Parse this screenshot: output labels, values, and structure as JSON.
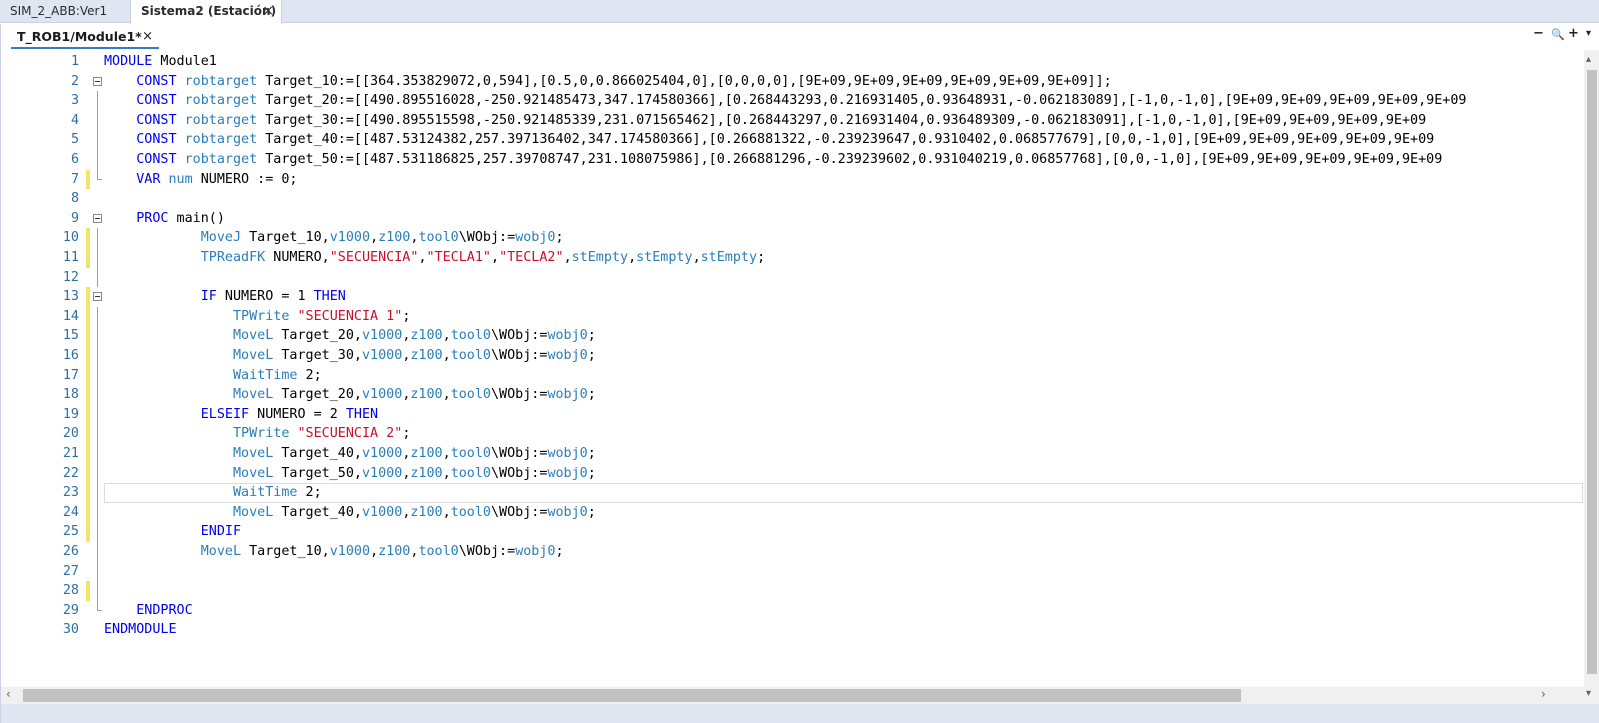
{
  "tabs": [
    {
      "label": "SIM_2_ABB:Ver1"
    },
    {
      "label": "Sistema2 (Estación)",
      "close": "×"
    }
  ],
  "editor_tab": {
    "label": "T_ROB1/Module1*",
    "close": "×"
  },
  "controls": {
    "minimize": "−",
    "zoom": "🔍",
    "add": "+",
    "menu": "▾"
  },
  "scrollbar": {
    "left_arrow": "‹",
    "right_arrow": "›",
    "up_arrow": "▴",
    "down_arrow": "▾"
  },
  "code": {
    "line_numbers": [
      "1",
      "2",
      "3",
      "4",
      "5",
      "6",
      "7",
      "8",
      "9",
      "10",
      "11",
      "12",
      "13",
      "14",
      "15",
      "16",
      "17",
      "18",
      "19",
      "20",
      "21",
      "22",
      "23",
      "24",
      "25",
      "26",
      "27",
      "28",
      "29",
      "30"
    ],
    "lines": [
      [
        [
          "kw",
          "MODULE"
        ],
        [
          "id",
          " Module1"
        ]
      ],
      [
        [
          "id",
          "    "
        ],
        [
          "kw",
          "CONST"
        ],
        [
          "id",
          " "
        ],
        [
          "ty",
          "robtarget"
        ],
        [
          "id",
          " Target_10:=[[364.353829072,0,594],[0.5,0,0.866025404,0],[0,0,0,0],[9E+09,9E+09,9E+09,9E+09,9E+09,9E+09]];"
        ]
      ],
      [
        [
          "id",
          "    "
        ],
        [
          "kw",
          "CONST"
        ],
        [
          "id",
          " "
        ],
        [
          "ty",
          "robtarget"
        ],
        [
          "id",
          " Target_20:=[[490.895516028,-250.921485473,347.174580366],[0.268443293,0.216931405,0.93648931,-0.062183089],[-1,0,-1,0],[9E+09,9E+09,9E+09,9E+09,9E+09"
        ]
      ],
      [
        [
          "id",
          "    "
        ],
        [
          "kw",
          "CONST"
        ],
        [
          "id",
          " "
        ],
        [
          "ty",
          "robtarget"
        ],
        [
          "id",
          " Target_30:=[[490.895515598,-250.921485339,231.071565462],[0.268443297,0.216931404,0.936489309,-0.062183091],[-1,0,-1,0],[9E+09,9E+09,9E+09,9E+09"
        ]
      ],
      [
        [
          "id",
          "    "
        ],
        [
          "kw",
          "CONST"
        ],
        [
          "id",
          " "
        ],
        [
          "ty",
          "robtarget"
        ],
        [
          "id",
          " Target_40:=[[487.53124382,257.397136402,347.174580366],[0.266881322,-0.239239647,0.9310402,0.068577679],[0,0,-1,0],[9E+09,9E+09,9E+09,9E+09,9E+09"
        ]
      ],
      [
        [
          "id",
          "    "
        ],
        [
          "kw",
          "CONST"
        ],
        [
          "id",
          " "
        ],
        [
          "ty",
          "robtarget"
        ],
        [
          "id",
          " Target_50:=[[487.531186825,257.39708747,231.108075986],[0.266881296,-0.239239602,0.931040219,0.06857768],[0,0,-1,0],[9E+09,9E+09,9E+09,9E+09,9E+09"
        ]
      ],
      [
        [
          "id",
          "    "
        ],
        [
          "kw",
          "VAR"
        ],
        [
          "id",
          " "
        ],
        [
          "ty",
          "num"
        ],
        [
          "id",
          " NUMERO := 0;"
        ]
      ],
      [
        [
          "id",
          ""
        ]
      ],
      [
        [
          "id",
          "    "
        ],
        [
          "kw",
          "PROC"
        ],
        [
          "id",
          " main()"
        ]
      ],
      [
        [
          "id",
          "            "
        ],
        [
          "fn",
          "MoveJ"
        ],
        [
          "id",
          " Target_10,"
        ],
        [
          "pm",
          "v1000"
        ],
        [
          "id",
          ","
        ],
        [
          "pm",
          "z100"
        ],
        [
          "id",
          ","
        ],
        [
          "pm",
          "tool0"
        ],
        [
          "id",
          "\\WObj:="
        ],
        [
          "pm",
          "wobj0"
        ],
        [
          "id",
          ";"
        ]
      ],
      [
        [
          "id",
          "            "
        ],
        [
          "fn",
          "TPReadFK"
        ],
        [
          "id",
          " NUMERO,"
        ],
        [
          "str",
          "\"SECUENCIA\""
        ],
        [
          "id",
          ","
        ],
        [
          "str",
          "\"TECLA1\""
        ],
        [
          "id",
          ","
        ],
        [
          "str",
          "\"TECLA2\""
        ],
        [
          "id",
          ","
        ],
        [
          "pm",
          "stEmpty"
        ],
        [
          "id",
          ","
        ],
        [
          "pm",
          "stEmpty"
        ],
        [
          "id",
          ","
        ],
        [
          "pm",
          "stEmpty"
        ],
        [
          "id",
          ";"
        ]
      ],
      [
        [
          "id",
          ""
        ]
      ],
      [
        [
          "id",
          "            "
        ],
        [
          "kw",
          "IF"
        ],
        [
          "id",
          " NUMERO = 1 "
        ],
        [
          "kw",
          "THEN"
        ]
      ],
      [
        [
          "id",
          "                "
        ],
        [
          "fn",
          "TPWrite"
        ],
        [
          "id",
          " "
        ],
        [
          "str",
          "\"SECUENCIA 1\""
        ],
        [
          "id",
          ";"
        ]
      ],
      [
        [
          "id",
          "                "
        ],
        [
          "fn",
          "MoveL"
        ],
        [
          "id",
          " Target_20,"
        ],
        [
          "pm",
          "v1000"
        ],
        [
          "id",
          ","
        ],
        [
          "pm",
          "z100"
        ],
        [
          "id",
          ","
        ],
        [
          "pm",
          "tool0"
        ],
        [
          "id",
          "\\WObj:="
        ],
        [
          "pm",
          "wobj0"
        ],
        [
          "id",
          ";"
        ]
      ],
      [
        [
          "id",
          "                "
        ],
        [
          "fn",
          "MoveL"
        ],
        [
          "id",
          " Target_30,"
        ],
        [
          "pm",
          "v1000"
        ],
        [
          "id",
          ","
        ],
        [
          "pm",
          "z100"
        ],
        [
          "id",
          ","
        ],
        [
          "pm",
          "tool0"
        ],
        [
          "id",
          "\\WObj:="
        ],
        [
          "pm",
          "wobj0"
        ],
        [
          "id",
          ";"
        ]
      ],
      [
        [
          "id",
          "                "
        ],
        [
          "fn",
          "WaitTime"
        ],
        [
          "id",
          " 2;"
        ]
      ],
      [
        [
          "id",
          "                "
        ],
        [
          "fn",
          "MoveL"
        ],
        [
          "id",
          " Target_20,"
        ],
        [
          "pm",
          "v1000"
        ],
        [
          "id",
          ","
        ],
        [
          "pm",
          "z100"
        ],
        [
          "id",
          ","
        ],
        [
          "pm",
          "tool0"
        ],
        [
          "id",
          "\\WObj:="
        ],
        [
          "pm",
          "wobj0"
        ],
        [
          "id",
          ";"
        ]
      ],
      [
        [
          "id",
          "            "
        ],
        [
          "kw",
          "ELSEIF"
        ],
        [
          "id",
          " NUMERO = 2 "
        ],
        [
          "kw",
          "THEN"
        ]
      ],
      [
        [
          "id",
          "                "
        ],
        [
          "fn",
          "TPWrite"
        ],
        [
          "id",
          " "
        ],
        [
          "str",
          "\"SECUENCIA 2\""
        ],
        [
          "id",
          ";"
        ]
      ],
      [
        [
          "id",
          "                "
        ],
        [
          "fn",
          "MoveL"
        ],
        [
          "id",
          " Target_40,"
        ],
        [
          "pm",
          "v1000"
        ],
        [
          "id",
          ","
        ],
        [
          "pm",
          "z100"
        ],
        [
          "id",
          ","
        ],
        [
          "pm",
          "tool0"
        ],
        [
          "id",
          "\\WObj:="
        ],
        [
          "pm",
          "wobj0"
        ],
        [
          "id",
          ";"
        ]
      ],
      [
        [
          "id",
          "                "
        ],
        [
          "fn",
          "MoveL"
        ],
        [
          "id",
          " Target_50,"
        ],
        [
          "pm",
          "v1000"
        ],
        [
          "id",
          ","
        ],
        [
          "pm",
          "z100"
        ],
        [
          "id",
          ","
        ],
        [
          "pm",
          "tool0"
        ],
        [
          "id",
          "\\WObj:="
        ],
        [
          "pm",
          "wobj0"
        ],
        [
          "id",
          ";"
        ]
      ],
      [
        [
          "id",
          "                "
        ],
        [
          "fn",
          "WaitTime"
        ],
        [
          "id",
          " 2;"
        ]
      ],
      [
        [
          "id",
          "                "
        ],
        [
          "fn",
          "MoveL"
        ],
        [
          "id",
          " Target_40,"
        ],
        [
          "pm",
          "v1000"
        ],
        [
          "id",
          ","
        ],
        [
          "pm",
          "z100"
        ],
        [
          "id",
          ","
        ],
        [
          "pm",
          "tool0"
        ],
        [
          "id",
          "\\WObj:="
        ],
        [
          "pm",
          "wobj0"
        ],
        [
          "id",
          ";"
        ]
      ],
      [
        [
          "id",
          "            "
        ],
        [
          "kw",
          "ENDIF"
        ]
      ],
      [
        [
          "id",
          "            "
        ],
        [
          "fn",
          "MoveL"
        ],
        [
          "id",
          " Target_10,"
        ],
        [
          "pm",
          "v1000"
        ],
        [
          "id",
          ","
        ],
        [
          "pm",
          "z100"
        ],
        [
          "id",
          ","
        ],
        [
          "pm",
          "tool0"
        ],
        [
          "id",
          "\\WObj:="
        ],
        [
          "pm",
          "wobj0"
        ],
        [
          "id",
          ";"
        ]
      ],
      [
        [
          "id",
          ""
        ]
      ],
      [
        [
          "id",
          ""
        ]
      ],
      [
        [
          "id",
          "    "
        ],
        [
          "kw",
          "ENDPROC"
        ]
      ],
      [
        [
          "kw",
          "ENDMODULE"
        ]
      ]
    ],
    "modified_lines": [
      7,
      10,
      11,
      13,
      14,
      15,
      16,
      17,
      18,
      19,
      20,
      21,
      22,
      23,
      24,
      25,
      28
    ],
    "fold_lines": [
      2,
      9,
      13
    ],
    "current_line": 23
  },
  "colors": {
    "keyword": "#0000ee",
    "type": "#2b7fb8",
    "string": "#c8102e",
    "line_number": "#2f6fa5",
    "change_marker": "#f3e46a",
    "tab_bar": "#dfe6f1"
  }
}
